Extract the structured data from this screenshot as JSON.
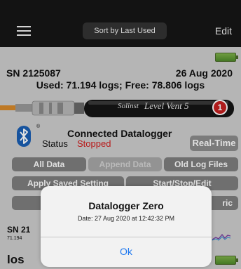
{
  "navbar": {
    "menu_icon": "hamburger-menu-icon",
    "sort_label": "Sort by Last Used",
    "edit_label": "Edit"
  },
  "logger": {
    "serial": "SN 2125087",
    "date": "26 Aug 2020",
    "usage": "Used: 71.194 logs; Free: 78.806 logs",
    "brand": "Solinst",
    "model": "Level Vent 5",
    "badge_count": "1",
    "battery_icon": "battery-full-icon"
  },
  "connection": {
    "bluetooth_icon": "bluetooth-icon",
    "registered_mark": "®",
    "title": "Connected Datalogger",
    "status_label": "Status",
    "status_value": "Stopped",
    "status_color": "#d21c1c"
  },
  "buttons": {
    "realtime": "Real-Time",
    "all_data": "All Data",
    "append_data": "Append Data",
    "old_log_files": "Old Log Files",
    "apply_saved_setting": "Apply Saved Setting",
    "start_stop_edit": "Start/Stop/Edit",
    "ric_partial": "ric"
  },
  "list_row": {
    "serial": "SN 21",
    "sub": "71.194",
    "graph_icon": "line-graph-icon"
  },
  "bottom": {
    "serial_partial": "los"
  },
  "alert": {
    "title": "Datalogger Zero",
    "message": "Date: 27 Aug 2020 at 12:42:32 PM",
    "ok_label": "Ok",
    "ok_color": "#1e78f0"
  },
  "colors": {
    "navbar_bg": "#161616",
    "button_bg": "#7f7f7f",
    "battery_green": "#7fb24a"
  }
}
